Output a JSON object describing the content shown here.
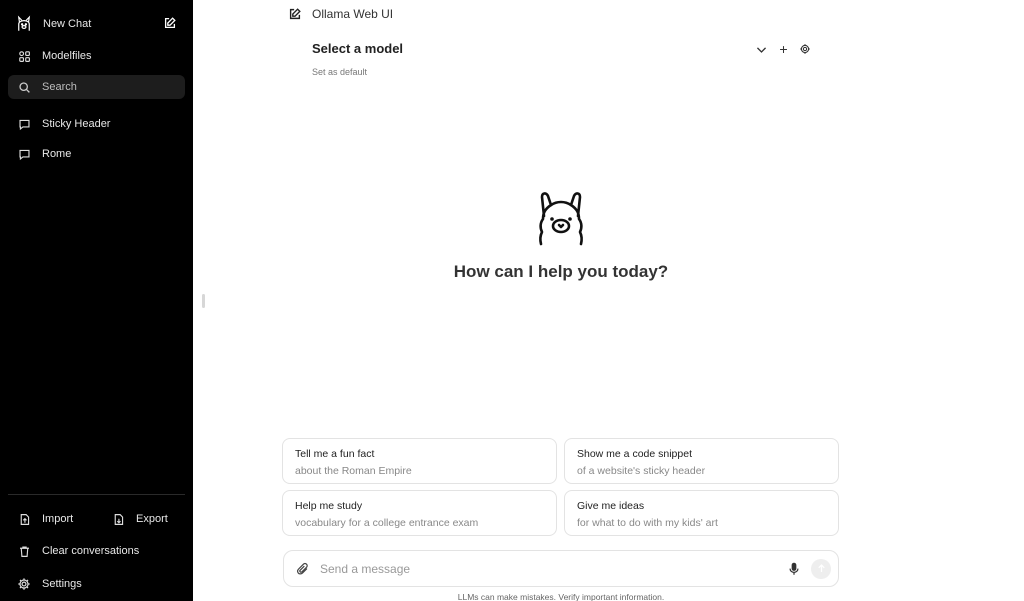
{
  "sidebar": {
    "new_chat": "New Chat",
    "modelfiles": "Modelfiles",
    "search_placeholder": "Search",
    "chats": [
      "Sticky Header",
      "Rome"
    ],
    "import": "Import",
    "export": "Export",
    "clear": "Clear conversations",
    "settings": "Settings"
  },
  "header": {
    "app_title": "Ollama Web UI",
    "model_select": "Select a model",
    "set_default": "Set as default"
  },
  "hero": {
    "prompt": "How can I help you today?"
  },
  "suggestions": [
    {
      "title": "Tell me a fun fact",
      "subtitle": "about the Roman Empire"
    },
    {
      "title": "Show me a code snippet",
      "subtitle": "of a website's sticky header"
    },
    {
      "title": "Help me study",
      "subtitle": "vocabulary for a college entrance exam"
    },
    {
      "title": "Give me ideas",
      "subtitle": "for what to do with my kids' art"
    }
  ],
  "composer": {
    "placeholder": "Send a message"
  },
  "footer": {
    "disclaimer": "LLMs can make mistakes. Verify important information."
  },
  "colors": {
    "sidebar_bg": "#000000",
    "search_bg": "#1d1d1d",
    "main_bg": "#ffffff"
  },
  "icons": [
    "ollama-logo-icon",
    "edit-icon",
    "grid-icon",
    "search-icon",
    "chat-bubble-icon",
    "import-icon",
    "export-icon",
    "trash-icon",
    "gear-icon",
    "chevron-down-icon",
    "plus-icon",
    "paperclip-icon",
    "mic-icon",
    "arrow-up-icon"
  ]
}
